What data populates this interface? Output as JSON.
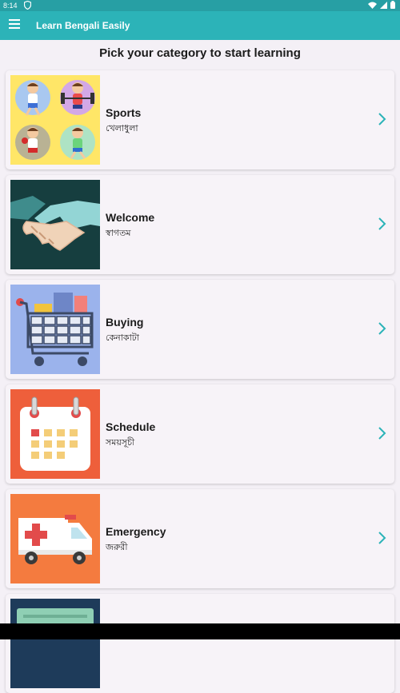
{
  "status": {
    "time": "8:14"
  },
  "app": {
    "title": "Learn Bengali Easily"
  },
  "heading": "Pick your category to start learning",
  "categories": [
    {
      "en": "Sports",
      "bn": "খেলাধুলা"
    },
    {
      "en": "Welcome",
      "bn": "স্বাগতম"
    },
    {
      "en": "Buying",
      "bn": "কেনাকাটা"
    },
    {
      "en": "Schedule",
      "bn": "সময়সূচী"
    },
    {
      "en": "Emergency",
      "bn": "জরুরী"
    },
    {
      "en": "",
      "bn": ""
    }
  ],
  "colors": {
    "status_bar": "#279FA4",
    "app_bar": "#2CB3B8",
    "chevron": "#2CB3B8",
    "background": "#F4F0F6"
  },
  "icons": [
    "menu-icon",
    "shield-icon",
    "wifi-icon",
    "battery-icon",
    "chevron-right-icon"
  ]
}
